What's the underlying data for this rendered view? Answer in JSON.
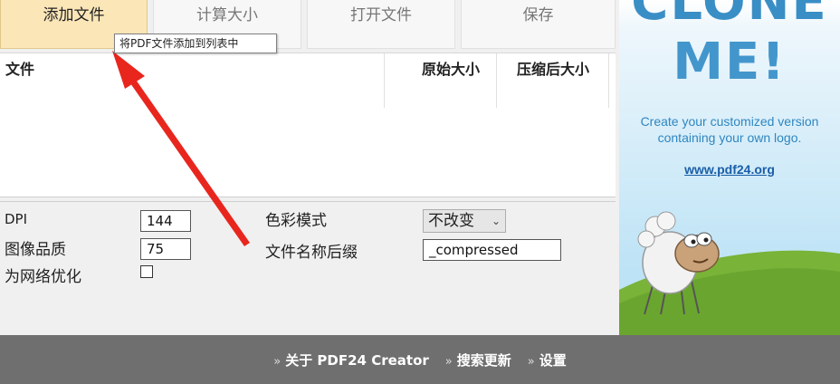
{
  "toolbar": {
    "add_files": "添加文件",
    "calc_size": "计算大小",
    "open_files": "打开文件",
    "save": "保存"
  },
  "tooltip": "将PDF文件添加到列表中",
  "file_list": {
    "columns": [
      "文件",
      "原始大小",
      "压缩后大小"
    ]
  },
  "settings": {
    "dpi_label": "DPI",
    "dpi_value": "144",
    "image_quality_label": "图像品质",
    "image_quality_value": "75",
    "web_optimize_label": "为网络优化",
    "web_optimize_checked": false,
    "color_mode_label": "色彩模式",
    "color_mode_value": "不改变",
    "suffix_label": "文件名称后缀",
    "suffix_value": "_compressed"
  },
  "ad": {
    "title_line1": "CLONE",
    "title_line2": "ME!",
    "text_line1": "Create your customized version",
    "text_line2": "containing your own logo.",
    "link": "www.pdf24.org"
  },
  "footer": {
    "about": "关于 PDF24 Creator",
    "search_updates": "搜索更新",
    "settings": "设置"
  },
  "colors": {
    "active_button": "#fbe6b8",
    "ad_text": "#2f86c1",
    "footer_bg": "#6f6f6f",
    "arrow": "#e8261e"
  }
}
